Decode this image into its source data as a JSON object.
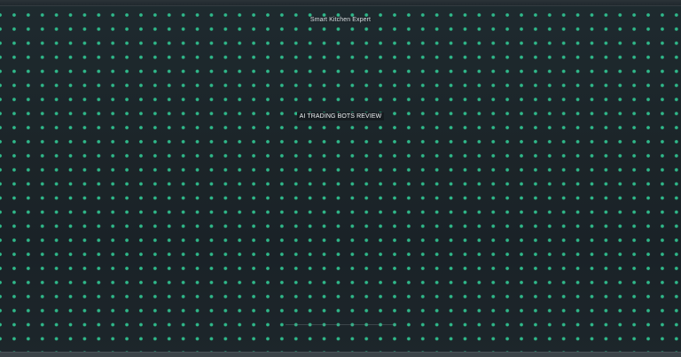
{
  "header": {
    "site_title": "Smart Kitchen Expert"
  },
  "main": {
    "headline": "AI TRADING BOTS REVIEW"
  },
  "theme": {
    "background": "#1c2529",
    "dot_color": "#2fb98a",
    "text_color": "#eef2f4"
  }
}
